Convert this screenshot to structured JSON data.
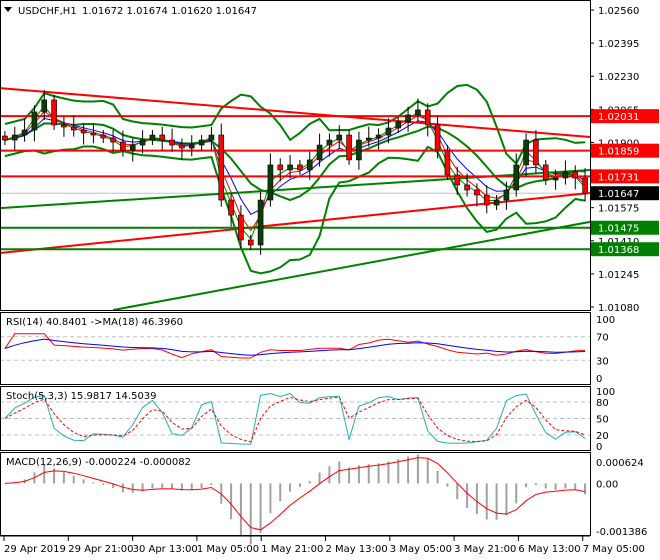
{
  "header": {
    "symbol_label": "USDCHF,H1",
    "ohlc": "1.01672 1.01674 1.01620 1.01647"
  },
  "indicators": {
    "rsi_label": "RSI(14) 40.8401  ->MA(18) 46.3960",
    "stoch_label": "Stoch(5,3,3) 15.9817 14.5039",
    "macd_label": "MACD(12,26,9) -0.000224 -0.000082"
  },
  "colors": {
    "bull": "#0b3d0b",
    "bear": "#ff0000",
    "band": "#008000",
    "level_red": "#ff0000",
    "level_green": "#008000",
    "ma_blue": "#0000ff",
    "signal": "#ff0000",
    "stoch_main": "#20b2aa"
  },
  "chart_data": {
    "type": "candlestick",
    "title": "USDCHF,H1",
    "ylim": [
      1.0108,
      1.0256
    ],
    "y_ticks": [
      "1.02560",
      "1.02395",
      "1.02230",
      "1.02065",
      "1.01900",
      "1.01575",
      "1.01410",
      "1.01245",
      "1.01080"
    ],
    "x_ticks": [
      "29 Apr 2019",
      "29 Apr 21:00",
      "30 Apr 13:00",
      "1 May 05:00",
      "1 May 21:00",
      "2 May 13:00",
      "3 May 05:00",
      "3 May 21:00",
      "6 May 13:00",
      "7 May 05:00"
    ],
    "closes": [
      1.01912,
      1.01937,
      1.01962,
      1.02052,
      1.02112,
      1.01987,
      1.01977,
      1.01962,
      1.01947,
      1.01937,
      1.01922,
      1.01902,
      1.01862,
      1.01887,
      1.01912,
      1.01937,
      1.01912,
      1.01887,
      1.01872,
      1.01887,
      1.01912,
      1.01937,
      1.01613,
      1.01538,
      1.01414,
      1.01389,
      1.01613,
      1.01788,
      1.01763,
      1.01788,
      1.01763,
      1.01813,
      1.01887,
      1.01912,
      1.01937,
      1.01813,
      1.01912,
      1.01922,
      1.01937,
      1.01972,
      1.02002,
      1.02037,
      1.02062,
      1.01987,
      1.01862,
      1.01738,
      1.01688,
      1.01663,
      1.01638,
      1.01588,
      1.01613,
      1.01663,
      1.01788,
      1.01912,
      1.01788,
      1.01713,
      1.01723,
      1.01753,
      1.01723,
      1.01647
    ],
    "levels": [
      {
        "price": 1.02031,
        "label": "1.02031",
        "color": "#ff0000"
      },
      {
        "price": 1.01859,
        "label": "1.01859",
        "color": "#ff0000"
      },
      {
        "price": 1.01731,
        "label": "1.01731",
        "color": "#ff0000"
      },
      {
        "price": 1.01475,
        "label": "1.01475",
        "color": "#008000"
      },
      {
        "price": 1.01368,
        "label": "1.01368",
        "color": "#008000"
      }
    ],
    "current_price": {
      "price": 1.01647,
      "label": "1.01647"
    },
    "trendlines": [
      {
        "from": [
          0,
          1.02171
        ],
        "to": [
          59,
          1.01927
        ],
        "color": "#ff0000"
      },
      {
        "from": [
          0,
          1.01349
        ],
        "to": [
          59,
          1.01648
        ],
        "color": "#ff0000"
      },
      {
        "from": [
          11,
          1.01065
        ],
        "to": [
          59,
          1.01504
        ],
        "color": "#008000"
      },
      {
        "from": [
          0,
          1.01573
        ],
        "to": [
          59,
          1.01763
        ],
        "color": "#008000"
      }
    ],
    "rsi": {
      "ylim": [
        0,
        100
      ],
      "ticks": [
        "100",
        "70",
        "30",
        "0"
      ],
      "value": 40.8401,
      "ma": 46.396
    },
    "stoch": {
      "ylim": [
        0,
        100
      ],
      "ticks": [
        "100",
        "80",
        "50",
        "20",
        "0"
      ],
      "main": 15.9817,
      "signal": 14.5039
    },
    "macd": {
      "ylim": [
        -0.001386,
        0.000624
      ],
      "ticks": [
        "0.000624",
        "0.00",
        "-0.001386"
      ],
      "main": -0.000224,
      "signal": -8.2e-05
    }
  }
}
